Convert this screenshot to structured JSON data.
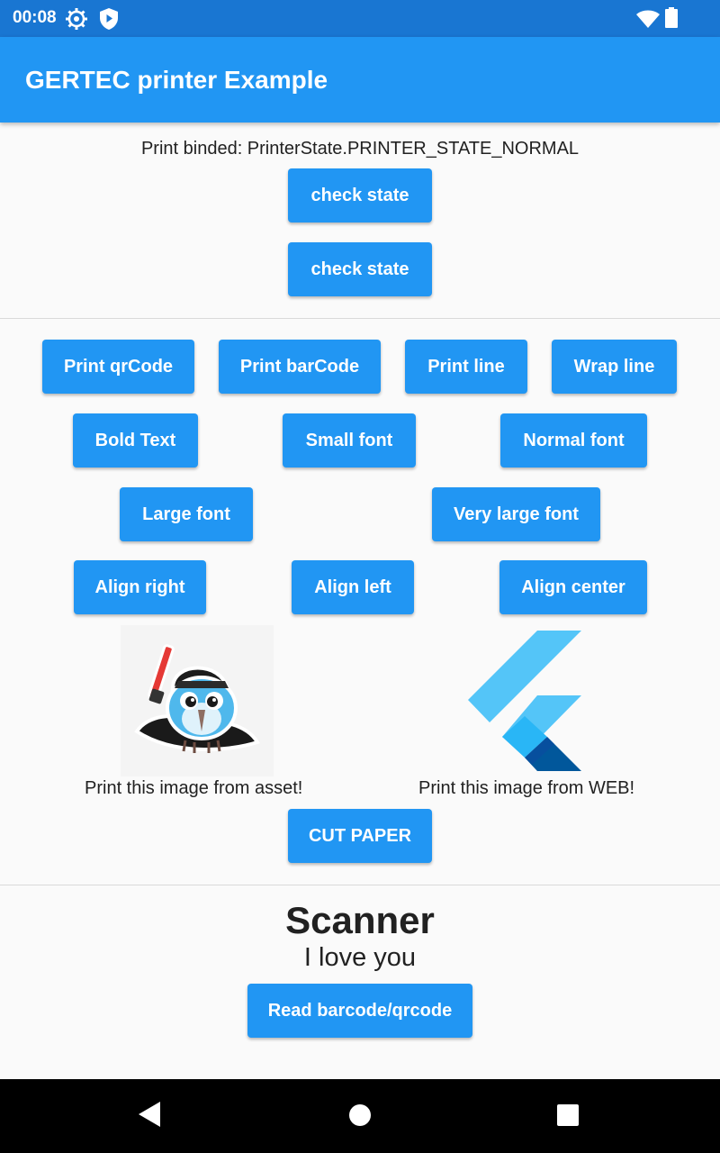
{
  "status_bar": {
    "time": "00:08"
  },
  "app_bar": {
    "title": "GERTEC printer Example"
  },
  "printer": {
    "status_text": "Print binded: PrinterState.PRINTER_STATE_NORMAL",
    "check_state_1": "check state",
    "check_state_2": "check state"
  },
  "actions": {
    "print_qrcode": "Print qrCode",
    "print_barcode": "Print barCode",
    "print_line": "Print line",
    "wrap_line": "Wrap line",
    "bold_text": "Bold Text",
    "small_font": "Small font",
    "normal_font": "Normal font",
    "large_font": "Large font",
    "very_large_font": "Very large font",
    "align_right": "Align right",
    "align_left": "Align left",
    "align_center": "Align center"
  },
  "images": {
    "asset_caption": "Print this image from asset!",
    "web_caption": "Print this image from WEB!"
  },
  "cut_paper": "CUT PAPER",
  "scanner": {
    "title": "Scanner",
    "subtitle": "I love you",
    "read_button": "Read barcode/qrcode"
  },
  "colors": {
    "primary": "#2196f3",
    "status_bar": "#1976d2"
  }
}
